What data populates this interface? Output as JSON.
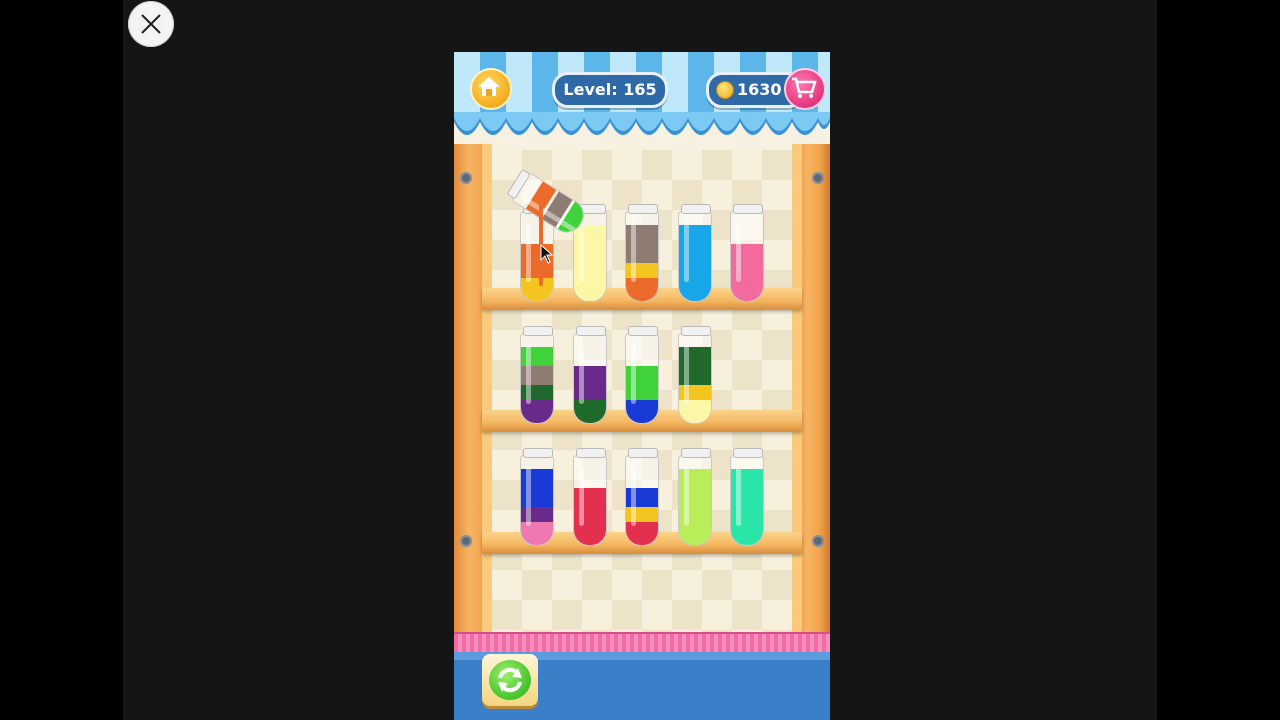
{
  "hud": {
    "level_text": "Level: 165",
    "coins_text": "1630"
  },
  "icons": {
    "close": "close-icon",
    "home": "home-icon",
    "coin": "coin-icon",
    "cart": "cart-icon",
    "refresh": "refresh-icon",
    "cursor": "mouse-cursor-icon"
  },
  "colors": {
    "orange": "#ec6b2a",
    "yellow": "#f3c51e",
    "pale_yellow": "#fbf7a6",
    "grey": "#8e7b72",
    "blue": "#17a6e8",
    "pink": "#f36a9c",
    "green": "#3fd23b",
    "dark_green": "#1f6a2a",
    "purple": "#6a2a8a",
    "royal_blue": "#1a3ad6",
    "red": "#e4304f",
    "lime": "#b9ee5a",
    "mint": "#29e6a8",
    "light_pink": "#f078b1"
  },
  "tubes": [
    {
      "row": 1,
      "layers": [
        "orange",
        "orange",
        "yellow"
      ]
    },
    {
      "row": 1,
      "layers": [
        "pale_yellow",
        "pale_yellow",
        "pale_yellow",
        "pale_yellow"
      ]
    },
    {
      "row": 1,
      "layers": [
        "grey",
        "grey",
        "yellow",
        "orange"
      ]
    },
    {
      "row": 1,
      "layers": [
        "blue",
        "blue",
        "blue",
        "blue"
      ]
    },
    {
      "row": 1,
      "layers": [
        "pink",
        "pink",
        "pink"
      ]
    },
    {
      "row": 2,
      "layers": [
        "green",
        "grey",
        "dark_green",
        "purple"
      ]
    },
    {
      "row": 2,
      "layers": [
        "purple",
        "purple",
        "dark_green"
      ]
    },
    {
      "row": 2,
      "layers": [
        "green",
        "green",
        "royal_blue"
      ]
    },
    {
      "row": 2,
      "layers": [
        "dark_green",
        "dark_green",
        "yellow",
        "pale_yellow"
      ]
    },
    {
      "row": 3,
      "layers": [
        "royal_blue",
        "royal_blue",
        "purple",
        "light_pink"
      ]
    },
    {
      "row": 3,
      "layers": [
        "red",
        "red",
        "red"
      ]
    },
    {
      "row": 3,
      "layers": [
        "royal_blue",
        "yellow",
        "red"
      ]
    },
    {
      "row": 3,
      "layers": [
        "lime",
        "lime",
        "lime",
        "lime"
      ]
    },
    {
      "row": 3,
      "layers": [
        "mint",
        "mint",
        "mint",
        "mint"
      ]
    }
  ],
  "pouring_tube": {
    "layers": [
      "orange",
      "grey",
      "green"
    ]
  }
}
